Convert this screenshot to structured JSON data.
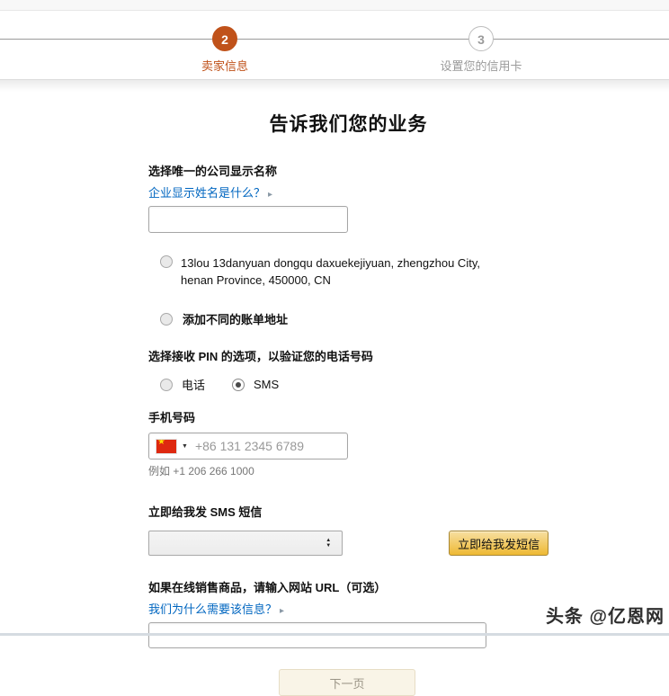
{
  "progress": {
    "steps": [
      {
        "number": "2",
        "label": "卖家信息",
        "state": "active"
      },
      {
        "number": "3",
        "label": "设置您的信用卡",
        "state": "inactive"
      }
    ]
  },
  "main": {
    "title": "告诉我们您的业务"
  },
  "form": {
    "company_name": {
      "label": "选择唯一的公司显示名称",
      "help_link": "企业显示姓名是什么？",
      "value": ""
    },
    "address_options": {
      "existing": "13lou 13danyuan dongqu daxuekejiyuan, zhengzhou City, henan Province, 450000, CN",
      "different_billing": "添加不同的账单地址",
      "selected": "none"
    },
    "pin_method": {
      "label": "选择接收 PIN 的选项，以验证您的电话号码",
      "option_phone": "电话",
      "option_sms": "SMS",
      "selected": "SMS"
    },
    "phone": {
      "label": "手机号码",
      "country_flag": "china",
      "placeholder": "+86 131 2345 6789",
      "value": "",
      "example": "例如 +1 206 266 1000"
    },
    "sms_now": {
      "label": "立即给我发 SMS 短信",
      "select_value": "",
      "button_label": "立即给我发短信"
    },
    "website": {
      "label": "如果在线销售商品，请输入网站 URL（可选）",
      "help_link": "我们为什么需要该信息？",
      "value": ""
    },
    "next_button_label": "下一页"
  },
  "watermark": "头条 @亿恩网",
  "icons": {
    "link_arrow": "▸",
    "flag_caret": "▼",
    "flag_star": "★",
    "select_up": "▲",
    "select_down": "▼"
  },
  "colors": {
    "accent_orange": "#c0521a",
    "link_blue": "#0066c0",
    "button_gradient_top": "#f7dfa1",
    "button_gradient_bottom": "#eeb933",
    "button_border": "#a88734",
    "inactive_gray": "#9a9a9a"
  }
}
